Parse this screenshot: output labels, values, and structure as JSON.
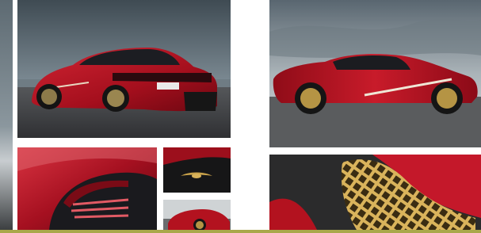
{
  "gallery": {
    "images": [
      {
        "name": "left-edge-strip",
        "alt": ""
      },
      {
        "name": "car-rear-three-quarter",
        "alt": ""
      },
      {
        "name": "car-side-profile",
        "alt": ""
      },
      {
        "name": "car-taillight-detail",
        "alt": ""
      },
      {
        "name": "car-badge-detail",
        "alt": ""
      },
      {
        "name": "car-front-small",
        "alt": ""
      },
      {
        "name": "car-grille-detail",
        "alt": ""
      }
    ]
  },
  "colors": {
    "car_red": "#b0121f",
    "sky_grey": "#7f8c95",
    "ground": "#4a4a48",
    "accent_bar": "#a9a84a",
    "gold": "#c9a24a"
  }
}
